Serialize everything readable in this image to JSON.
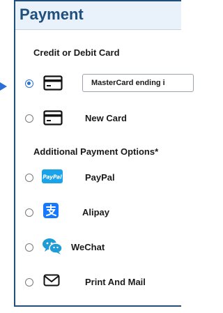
{
  "header": {
    "title": "Payment"
  },
  "sections": {
    "card_heading": "Credit or Debit Card",
    "additional_heading": "Additional Payment Options*"
  },
  "card_options": [
    {
      "label": "MasterCard ending i",
      "icon": "credit-card-icon",
      "selected": true
    },
    {
      "label": "New Card",
      "icon": "credit-card-icon",
      "selected": false
    }
  ],
  "additional_options": [
    {
      "label": "PayPal",
      "icon": "paypal-icon",
      "icon_text": "PayPal"
    },
    {
      "label": "Alipay",
      "icon": "alipay-icon"
    },
    {
      "label": "WeChat",
      "icon": "wechat-icon"
    },
    {
      "label": "Print And Mail",
      "icon": "envelope-icon"
    }
  ],
  "colors": {
    "accent": "#2a6fd6",
    "title": "#1f4f7a",
    "header_bg": "#e9f2fb",
    "paypal": "#1aa3e8",
    "alipay": "#1677ff",
    "wechat_primary": "#1f9bd6"
  }
}
